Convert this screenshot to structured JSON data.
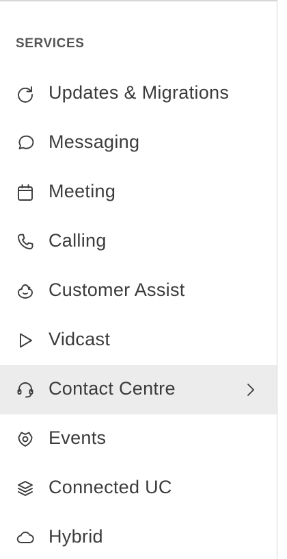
{
  "sidebar": {
    "section_heading": "SERVICES",
    "items": [
      {
        "label": "Updates & Migrations",
        "icon": "refresh-icon",
        "active": false
      },
      {
        "label": "Messaging",
        "icon": "chat-bubble-icon",
        "active": false
      },
      {
        "label": "Meeting",
        "icon": "calendar-icon",
        "active": false
      },
      {
        "label": "Calling",
        "icon": "phone-icon",
        "active": false
      },
      {
        "label": "Customer Assist",
        "icon": "customer-assist-icon",
        "active": false
      },
      {
        "label": "Vidcast",
        "icon": "play-icon",
        "active": false
      },
      {
        "label": "Contact Centre",
        "icon": "headset-icon",
        "active": true
      },
      {
        "label": "Events",
        "icon": "events-icon",
        "active": false
      },
      {
        "label": "Connected UC",
        "icon": "layers-icon",
        "active": false
      },
      {
        "label": "Hybrid",
        "icon": "cloud-icon",
        "active": false
      }
    ]
  },
  "colors": {
    "active_background": "#ececec",
    "text": "#3b3b3b",
    "heading": "#545454",
    "border": "#d6d6d6"
  }
}
